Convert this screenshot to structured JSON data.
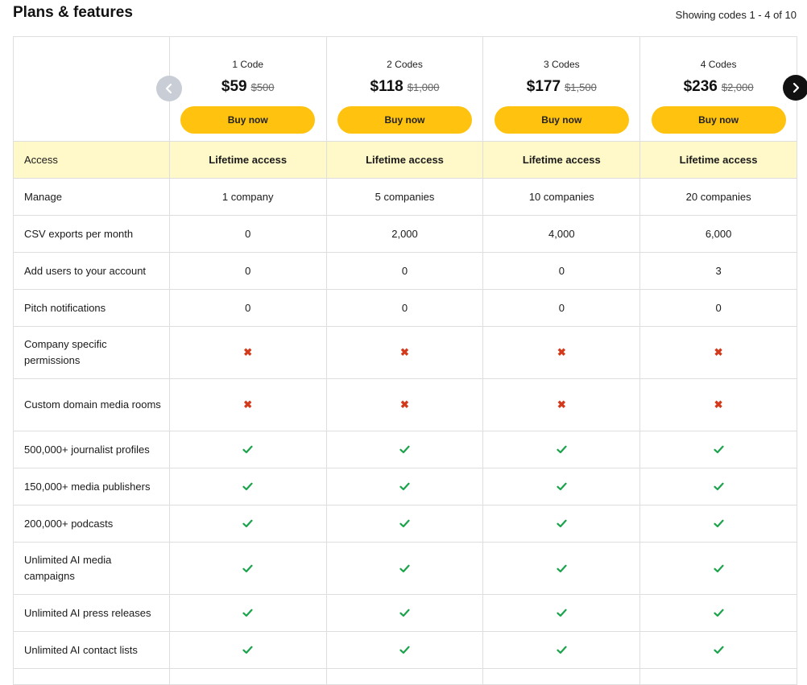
{
  "page": {
    "title": "Plans & features",
    "showing": "Showing codes 1 - 4 of 10"
  },
  "plans": [
    {
      "name": "1 Code",
      "price": "$59",
      "old_price": "$500",
      "button": "Buy now"
    },
    {
      "name": "2 Codes",
      "price": "$118",
      "old_price": "$1,000",
      "button": "Buy now"
    },
    {
      "name": "3 Codes",
      "price": "$177",
      "old_price": "$1,500",
      "button": "Buy now"
    },
    {
      "name": "4 Codes",
      "price": "$236",
      "old_price": "$2,000",
      "button": "Buy now"
    }
  ],
  "features": [
    {
      "label": "Access",
      "values": [
        "Lifetime access",
        "Lifetime access",
        "Lifetime access",
        "Lifetime access"
      ]
    },
    {
      "label": "Manage",
      "values": [
        "1 company",
        "5 companies",
        "10 companies",
        "20 companies"
      ]
    },
    {
      "label": "CSV exports per month",
      "values": [
        "0",
        "2,000",
        "4,000",
        "6,000"
      ]
    },
    {
      "label": "Add users to your account",
      "values": [
        "0",
        "0",
        "0",
        "3"
      ]
    },
    {
      "label": "Pitch notifications",
      "values": [
        "0",
        "0",
        "0",
        "0"
      ]
    },
    {
      "label": "Company specific permissions",
      "values": [
        "no",
        "no",
        "no",
        "no"
      ]
    },
    {
      "label": "Custom domain media rooms",
      "values": [
        "no",
        "no",
        "no",
        "no"
      ]
    },
    {
      "label": "500,000+ journalist profiles",
      "values": [
        "yes",
        "yes",
        "yes",
        "yes"
      ]
    },
    {
      "label": "150,000+ media publishers",
      "values": [
        "yes",
        "yes",
        "yes",
        "yes"
      ]
    },
    {
      "label": "200,000+ podcasts",
      "values": [
        "yes",
        "yes",
        "yes",
        "yes"
      ]
    },
    {
      "label": "Unlimited AI media campaigns",
      "values": [
        "yes",
        "yes",
        "yes",
        "yes"
      ]
    },
    {
      "label": "Unlimited AI press releases",
      "values": [
        "yes",
        "yes",
        "yes",
        "yes"
      ]
    },
    {
      "label": "Unlimited AI contact lists",
      "values": [
        "yes",
        "yes",
        "yes",
        "yes"
      ]
    }
  ],
  "icons": {
    "yes": "check-icon",
    "no": "cross-icon",
    "prev": "chevron-left-icon",
    "next": "chevron-right-icon"
  },
  "colors": {
    "button": "#ffc20e",
    "access_row": "#fff8c9",
    "check": "#1aa34a",
    "cross": "#d33a1c",
    "next_nav": "#111111",
    "prev_nav": "#c8cdd6"
  }
}
